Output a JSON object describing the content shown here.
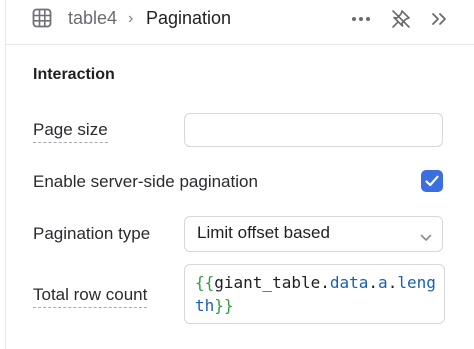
{
  "header": {
    "breadcrumb": "table4",
    "separator": "›",
    "title": "Pagination"
  },
  "section": {
    "heading": "Interaction"
  },
  "fields": {
    "page_size": {
      "label": "Page size",
      "value": ""
    },
    "server_side": {
      "label": "Enable server-side pagination",
      "checked": true
    },
    "pagination_type": {
      "label": "Pagination type",
      "value": "Limit offset based"
    },
    "total_row_count": {
      "label": "Total row count",
      "code_open": "{{",
      "code_obj": "giant_table",
      "code_dot1": ".",
      "code_p1": "data",
      "code_dot2": ".",
      "code_p2": "a",
      "code_dot3": ".",
      "code_p3a": "leng",
      "code_p3b": "th",
      "code_close": "}}"
    }
  },
  "colors": {
    "accent": "#3b6fe0",
    "template_brace": "#2f9e44",
    "template_property": "#1a5fb4"
  },
  "icons": {
    "table": "table-grid-icon",
    "more": "more-horizontal-icon",
    "pin": "pin-off-icon",
    "collapse": "double-chevron-right-icon",
    "dropdown": "chevron-down-icon",
    "check": "checkmark-icon"
  }
}
